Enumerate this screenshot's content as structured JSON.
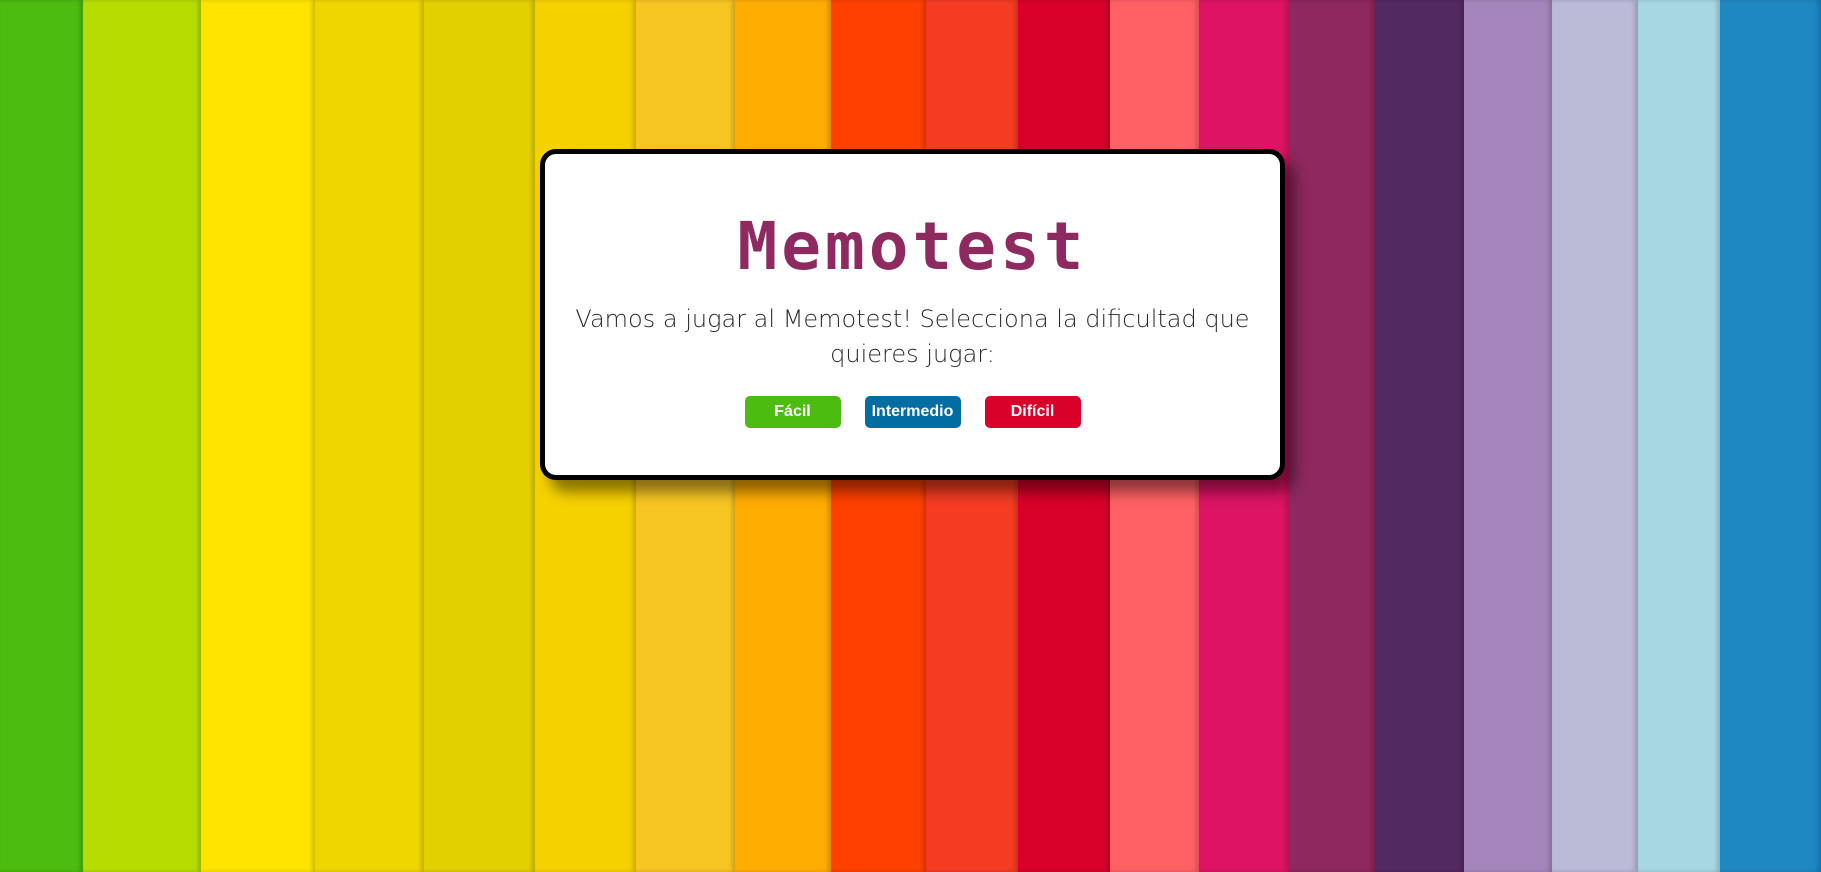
{
  "background": {
    "stripes": [
      {
        "color": "#4cbc10",
        "w": 88
      },
      {
        "color": "#b7dd00",
        "w": 125
      },
      {
        "color": "#fde500",
        "w": 120
      },
      {
        "color": "#f0d600",
        "w": 115
      },
      {
        "color": "#e3d000",
        "w": 118
      },
      {
        "color": "#f6d100",
        "w": 107
      },
      {
        "color": "#f7c623",
        "w": 104
      },
      {
        "color": "#ffad00",
        "w": 102
      },
      {
        "color": "#ff4000",
        "w": 100
      },
      {
        "color": "#f53c22",
        "w": 98
      },
      {
        "color": "#d9002a",
        "w": 97
      },
      {
        "color": "#ff6165",
        "w": 94
      },
      {
        "color": "#dc1463",
        "w": 95
      },
      {
        "color": "#8f285e",
        "w": 91
      },
      {
        "color": "#532962",
        "w": 94
      },
      {
        "color": "#a685bd",
        "w": 94
      },
      {
        "color": "#bbbad7",
        "w": 91
      },
      {
        "color": "#a7d7e3",
        "w": 86
      },
      {
        "color": "#1e88c2",
        "w": 107
      }
    ]
  },
  "card": {
    "title": "Memotest",
    "subtitle": "Vamos a jugar al Memotest! Selecciona la dificultad que quieres jugar:"
  },
  "buttons": {
    "easy": {
      "label": "Fácil",
      "color": "#4cbc10"
    },
    "medium": {
      "label": "Intermedio",
      "color": "#006ea3"
    },
    "hard": {
      "label": "Difícil",
      "color": "#d9002a"
    }
  },
  "colors": {
    "title": "#8e2a5f",
    "card_bg": "#ffffff",
    "card_border": "#000000"
  }
}
